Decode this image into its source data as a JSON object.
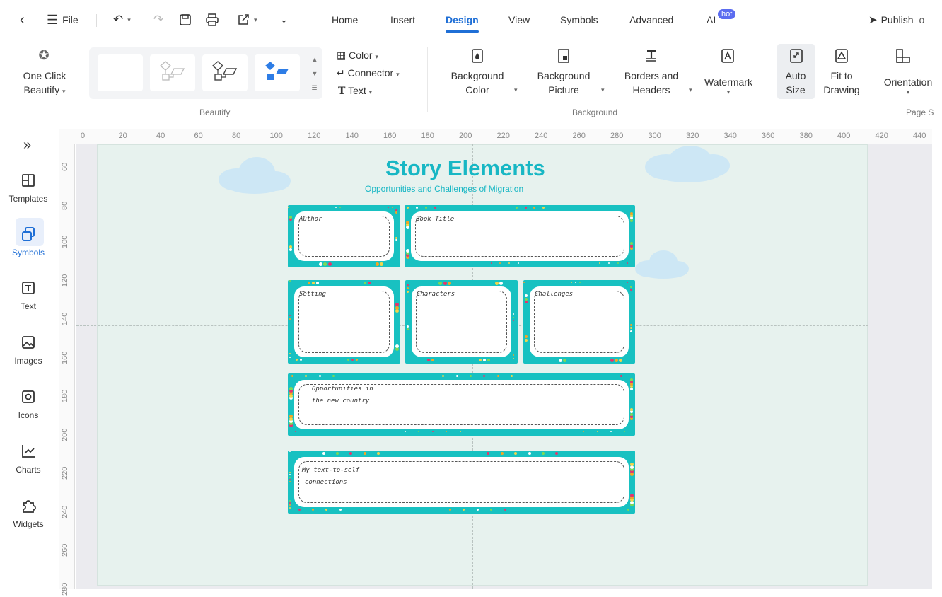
{
  "topbar": {
    "back_icon": "chevron-left-icon",
    "file_label": "File",
    "tabs": [
      "Home",
      "Insert",
      "Design",
      "View",
      "Symbols",
      "Advanced",
      "AI"
    ],
    "active_tab": "Design",
    "ai_badge": "hot",
    "publish_label": "Publish"
  },
  "ribbon": {
    "one_click_beautify": [
      "One Click",
      "Beautify"
    ],
    "color_label": "Color",
    "connector_label": "Connector",
    "text_label": "Text",
    "beautify_group": "Beautify",
    "background_color": [
      "Background",
      "Color"
    ],
    "background_picture": [
      "Background",
      "Picture"
    ],
    "borders_headers": [
      "Borders and",
      "Headers"
    ],
    "watermark": "Watermark",
    "background_group": "Background",
    "auto_size": [
      "Auto",
      "Size"
    ],
    "fit_to_drawing": [
      "Fit to",
      "Drawing"
    ],
    "orientation": "Orientation",
    "page_setup_group": "Page S"
  },
  "sidebar": {
    "expand_icon": "double-chevron-right-icon",
    "items": [
      {
        "label": "Templates",
        "icon": "templates-icon"
      },
      {
        "label": "Symbols",
        "icon": "symbols-icon"
      },
      {
        "label": "Text",
        "icon": "text-icon"
      },
      {
        "label": "Images",
        "icon": "images-icon"
      },
      {
        "label": "Icons",
        "icon": "icons-icon"
      },
      {
        "label": "Charts",
        "icon": "charts-icon"
      },
      {
        "label": "Widgets",
        "icon": "widgets-icon"
      }
    ],
    "active": "Symbols"
  },
  "ruler": {
    "horizontal": [
      "0",
      "20",
      "40",
      "60",
      "80",
      "100",
      "120",
      "140",
      "160",
      "180",
      "200",
      "220",
      "240",
      "260",
      "280",
      "300",
      "320",
      "340",
      "360",
      "380",
      "400",
      "420",
      "440"
    ],
    "vertical": [
      "60",
      "80",
      "100",
      "120",
      "140",
      "160",
      "180",
      "200",
      "220",
      "240",
      "260",
      "280"
    ]
  },
  "diagram": {
    "title": "Story Elements",
    "subtitle": "Opportunities and Challenges of Migration",
    "cards": {
      "author": "Author",
      "book_title": "Book Title",
      "setting": "Setting",
      "characters": "Characters",
      "challenges": "Challenges",
      "opportunities": [
        "Opportunities in",
        "the new country"
      ],
      "connections": [
        "My text-to-self",
        "connections"
      ]
    }
  },
  "colors": {
    "accent": "#1f6fd6",
    "teal": "#18c1c1",
    "title": "#18b7c4",
    "page_bg": "#e7f2ee",
    "ai_badge": "#5b6cf0"
  }
}
